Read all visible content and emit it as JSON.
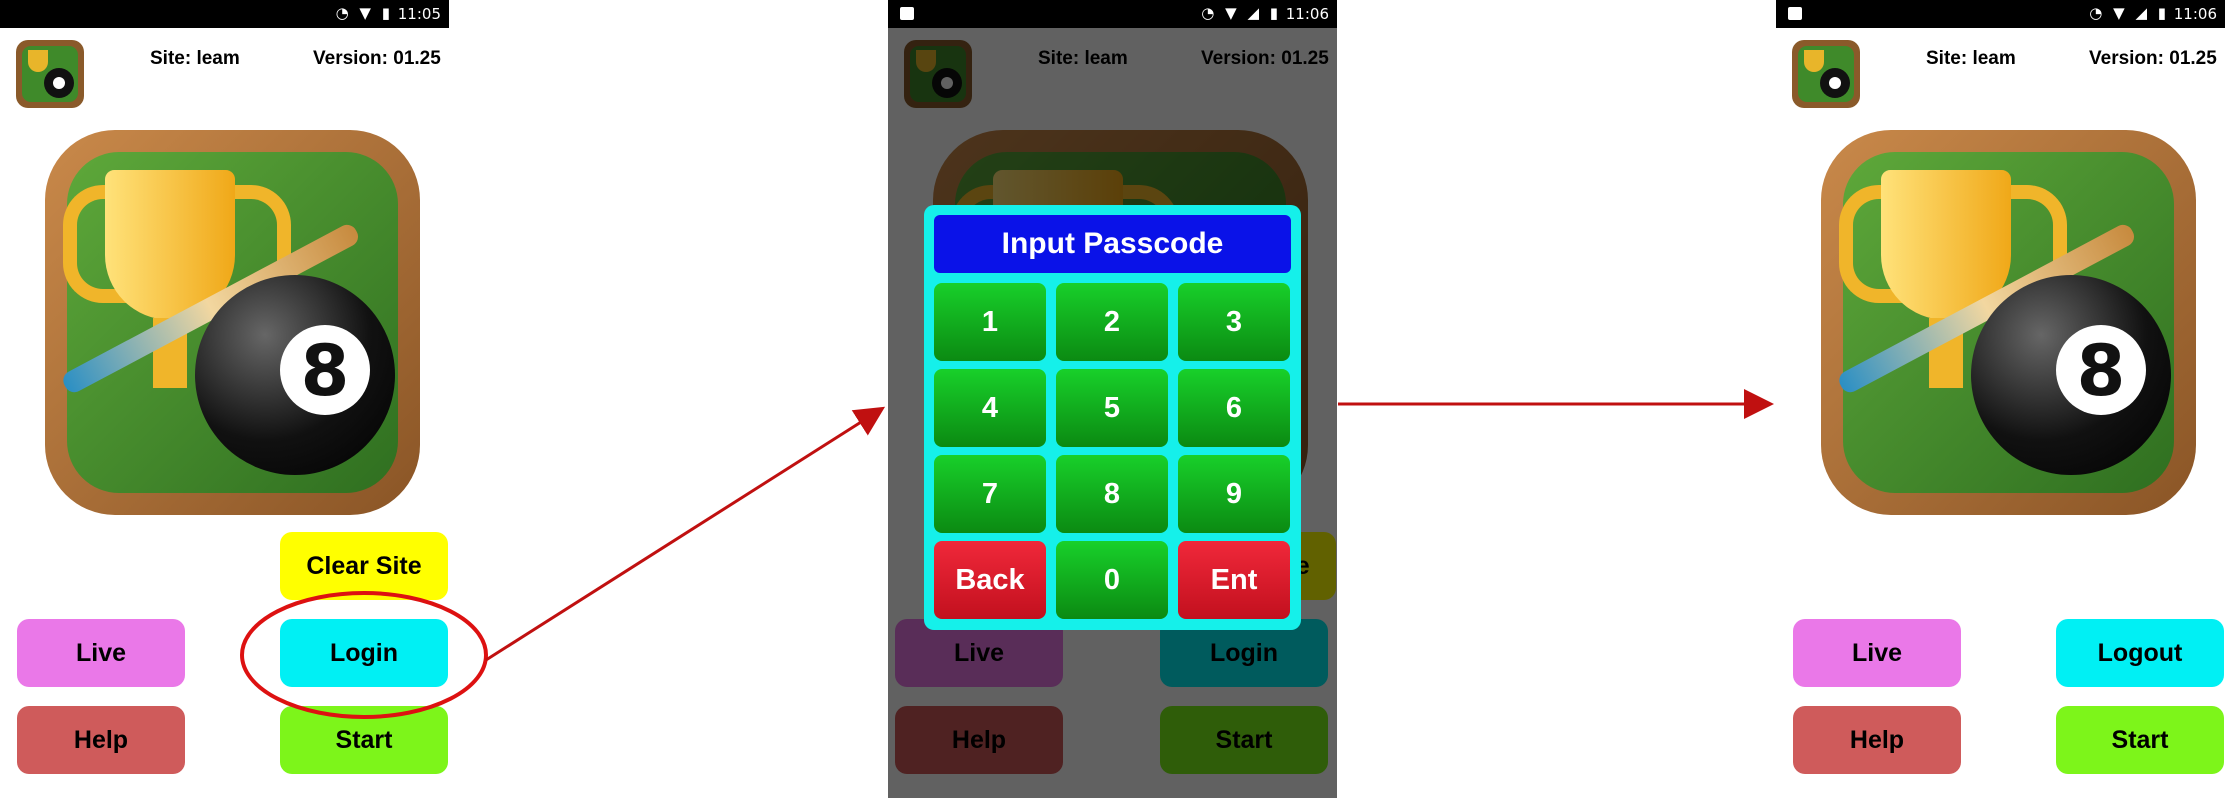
{
  "status_bar": {
    "screen1_icons": "◔ ▼ ▮",
    "screen1_time": "11:05",
    "screen2_icons": "◔ ▼ ◢ ▮",
    "screen2_time": "11:06",
    "screen3_icons": "◔ ▼ ◢ ▮",
    "screen3_time": "11:06"
  },
  "header": {
    "site": "Site: leam",
    "version": "Version: 01.25"
  },
  "buttons": {
    "clear_site": "Clear Site",
    "live": "Live",
    "login": "Login",
    "logout": "Logout",
    "help": "Help",
    "start": "Start"
  },
  "passcode_dialog": {
    "title": "Input Passcode",
    "keys": [
      "1",
      "2",
      "3",
      "4",
      "5",
      "6",
      "7",
      "8",
      "9",
      "Back",
      "0",
      "Ent"
    ]
  },
  "logo_ball_number": "8",
  "colors": {
    "clear_site": "#ffff00",
    "live": "#ea78e8",
    "login": "#00f0f4",
    "help": "#cf5b5b",
    "start": "#7df51a",
    "dialog_bg": "#15f0ea",
    "dialog_title": "#0a12e8",
    "key_green": "#18d02a",
    "key_red": "#e81e30",
    "annotation": "#c01010"
  }
}
